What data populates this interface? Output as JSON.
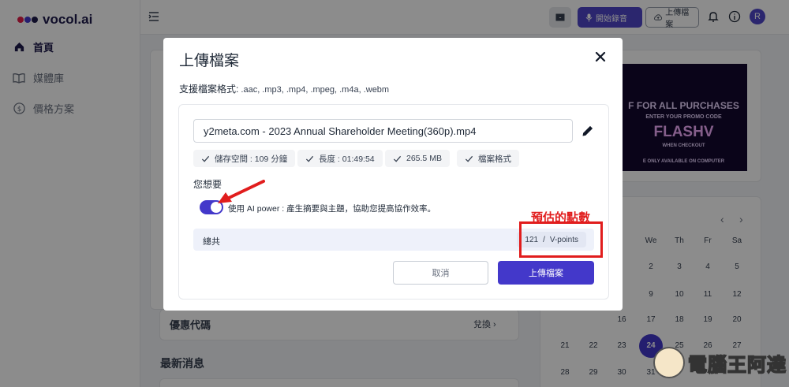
{
  "app": {
    "logo_text": "vocol.ai",
    "brand_color": "#4338ca"
  },
  "sidebar": {
    "items": [
      {
        "label": "首頁",
        "icon": "home-icon"
      },
      {
        "label": "媒體庫",
        "icon": "book-icon"
      },
      {
        "label": "價格方案",
        "icon": "dollar-icon"
      }
    ]
  },
  "topbar": {
    "record_label": "開始錄音",
    "upload_label": "上傳檔案",
    "avatar_initial": "R"
  },
  "background": {
    "promo_label": "優惠代碼",
    "promo_link": "兌換",
    "news_label": "最新消息",
    "banner_lines": [
      "F FOR ALL PURCHASES",
      "ENTER YOUR PROMO CODE",
      "FLASHV",
      "WHEN CHECKOUT",
      "E ONLY AVAILABLE ON COMPUTER"
    ],
    "calendar": {
      "weekdays": [
        "We",
        "Th",
        "Fr",
        "Sa"
      ],
      "rows": [
        [
          "2",
          "3",
          "4",
          "5"
        ],
        [
          "9",
          "10",
          "11",
          "12"
        ],
        [
          "16",
          "17",
          "18",
          "19",
          "20"
        ],
        [
          "21",
          "22",
          "23",
          "24",
          "25",
          "26",
          "27"
        ],
        [
          "28",
          "29",
          "30",
          "31"
        ]
      ]
    }
  },
  "modal": {
    "title": "上傳檔案",
    "formats_label": "支援檔案格式:",
    "formats_value": " .aac, .mp3, .mp4, .mpeg, .m4a, .webm",
    "filename": "y2meta.com - 2023 Annual Shareholder Meeting(360p).mp4",
    "chips": [
      "儲存空間 : 109 分鐘",
      "長度 : 01:49:54",
      "265.5 MB",
      "檔案格式"
    ],
    "want_label": "您想要",
    "ai_toggle_on": true,
    "ai_text": "使用 AI power : 產生摘要與主題，協助您提高協作效率。",
    "total_label": "總共",
    "points_value": "121",
    "points_sep": "/",
    "points_unit": "V-points",
    "cancel_label": "取消",
    "upload_label": "上傳檔案"
  },
  "annotation": {
    "label": "預估的點數",
    "color": "#e11d1d"
  },
  "watermark": {
    "text": "電腦王阿達"
  }
}
